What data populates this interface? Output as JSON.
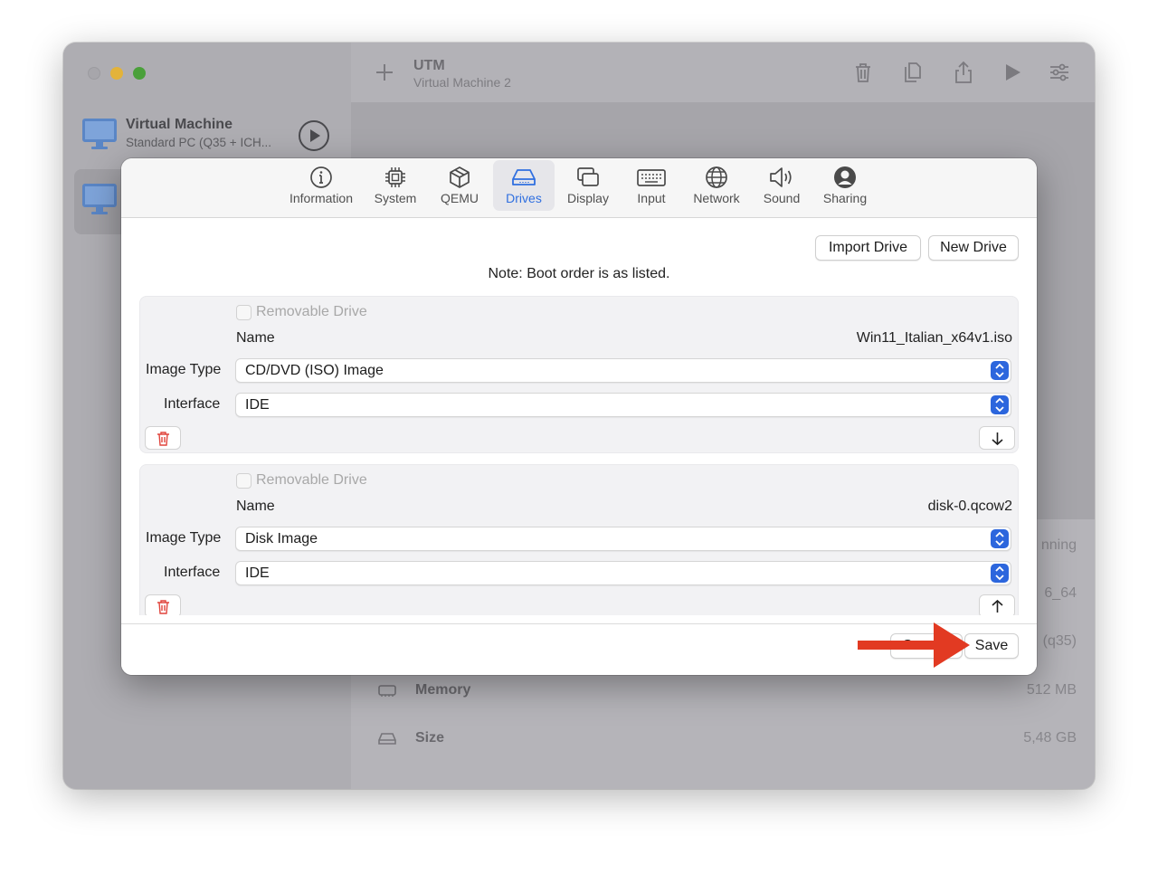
{
  "window": {
    "app_title": "UTM",
    "app_subtitle": "Virtual Machine 2"
  },
  "sidebar": {
    "items": [
      {
        "name": "Virtual Machine",
        "subtitle": "Standard PC (Q35 + ICH..."
      },
      {
        "name": "",
        "subtitle": ""
      }
    ]
  },
  "toolbar": {
    "icons": [
      "plus-icon",
      "trash-icon",
      "clone-icon",
      "share-icon",
      "play-icon",
      "settings-sliders-icon"
    ]
  },
  "info_rows": [
    {
      "key": "",
      "value": "nning"
    },
    {
      "key": "",
      "value": "6_64"
    },
    {
      "key": "",
      "value": "(q35)"
    },
    {
      "key": "Memory",
      "value": "512 MB"
    },
    {
      "key": "Size",
      "value": "5,48 GB"
    }
  ],
  "modal": {
    "tabs": [
      {
        "label": "Information",
        "icon": "info-icon"
      },
      {
        "label": "System",
        "icon": "chip-icon"
      },
      {
        "label": "QEMU",
        "icon": "cube-icon"
      },
      {
        "label": "Drives",
        "icon": "drive-icon",
        "active": true
      },
      {
        "label": "Display",
        "icon": "display-icon"
      },
      {
        "label": "Input",
        "icon": "keyboard-icon"
      },
      {
        "label": "Network",
        "icon": "globe-icon"
      },
      {
        "label": "Sound",
        "icon": "speaker-icon"
      },
      {
        "label": "Sharing",
        "icon": "person-icon"
      }
    ],
    "import_drive_label": "Import Drive",
    "new_drive_label": "New Drive",
    "note": "Note: Boot order is as listed.",
    "drives": [
      {
        "removable_label": "Removable Drive",
        "name_label": "Name",
        "name_value": "Win11_Italian_x64v1.iso",
        "image_type_label": "Image Type",
        "image_type_value": "CD/DVD (ISO) Image",
        "interface_label": "Interface",
        "interface_value": "IDE"
      },
      {
        "removable_label": "Removable Drive",
        "name_label": "Name",
        "name_value": "disk-0.qcow2",
        "image_type_label": "Image Type",
        "image_type_value": "Disk Image",
        "interface_label": "Interface",
        "interface_value": "IDE"
      }
    ],
    "cancel_label": "C",
    "save_label": "Save"
  },
  "colors": {
    "accent": "#2c66dd",
    "delete_red": "#e0443c",
    "annotation_arrow": "#e23a22"
  }
}
